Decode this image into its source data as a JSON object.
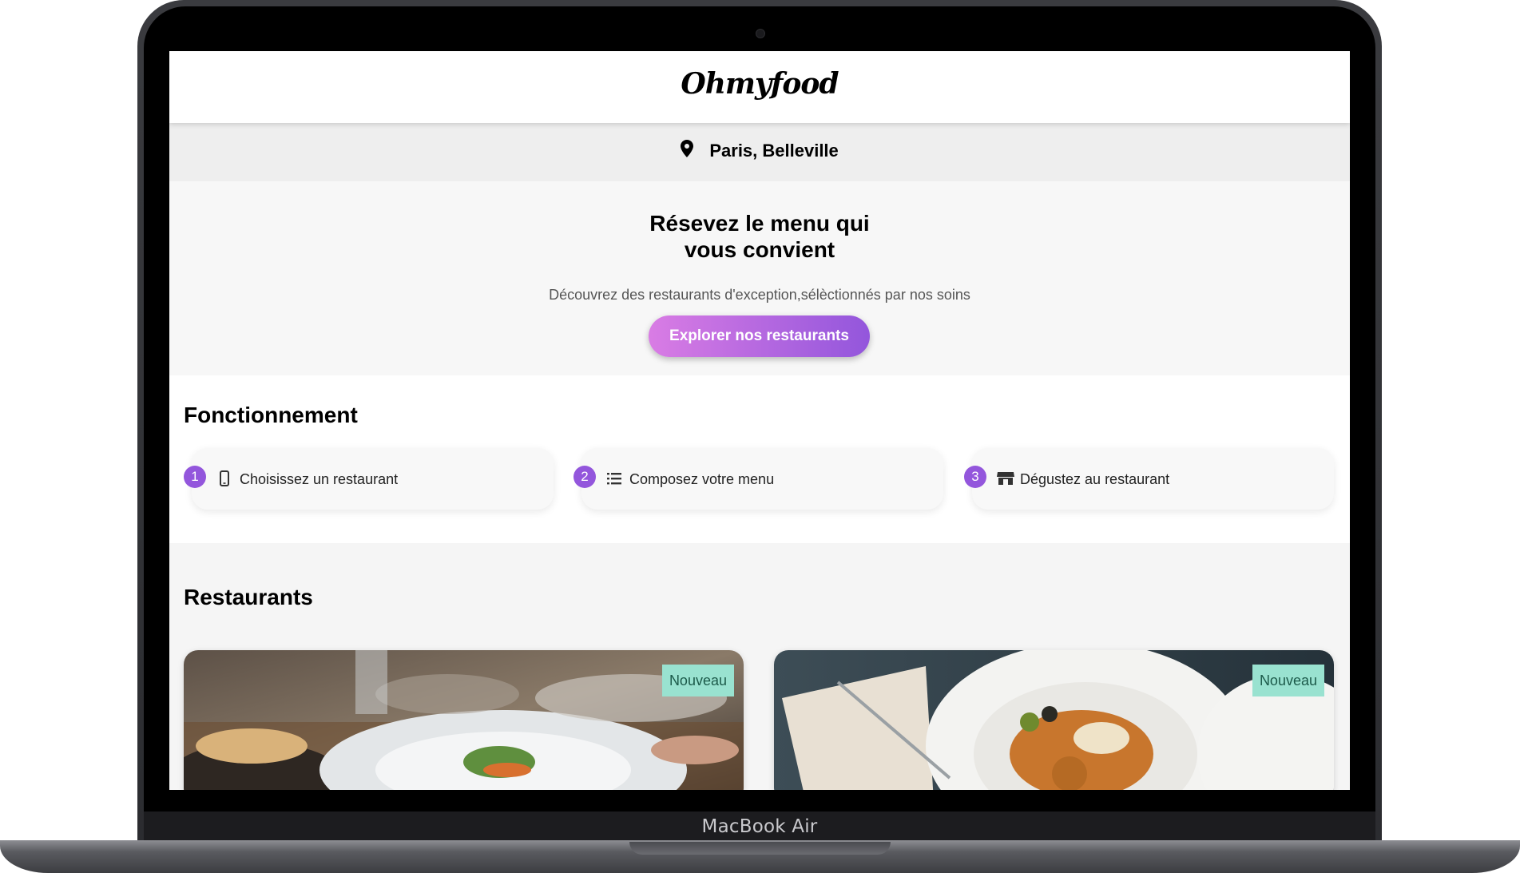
{
  "device": {
    "model_label": "MacBook Air"
  },
  "site": {
    "logo": "Ohmyfood",
    "location": "Paris, Belleville",
    "hero": {
      "title_line1": "Résevez le menu qui",
      "title_line2": "vous convient",
      "subtitle": "Découvrez des restaurants d'exception,sélèctionnés par nos soins",
      "cta_label": "Explorer nos restaurants"
    },
    "how_it_works": {
      "title": "Fonctionnement",
      "steps": [
        {
          "number": "1",
          "icon": "phone-icon",
          "label": "Choisissez un restaurant"
        },
        {
          "number": "2",
          "icon": "list-icon",
          "label": "Composez votre menu"
        },
        {
          "number": "3",
          "icon": "store-icon",
          "label": "Dégustez au restaurant"
        }
      ]
    },
    "restaurants": {
      "title": "Restaurants",
      "cards": [
        {
          "image": "plated-dish-restaurant-table-photo",
          "badge": "Nouveau"
        },
        {
          "image": "plate-with-food-and-menu-photo",
          "badge": "Nouveau"
        }
      ]
    }
  },
  "colors": {
    "accent_start": "#d97ce4",
    "accent_end": "#9356dc",
    "badge_bg": "#99e2d0",
    "step_number": "#9356dc"
  }
}
